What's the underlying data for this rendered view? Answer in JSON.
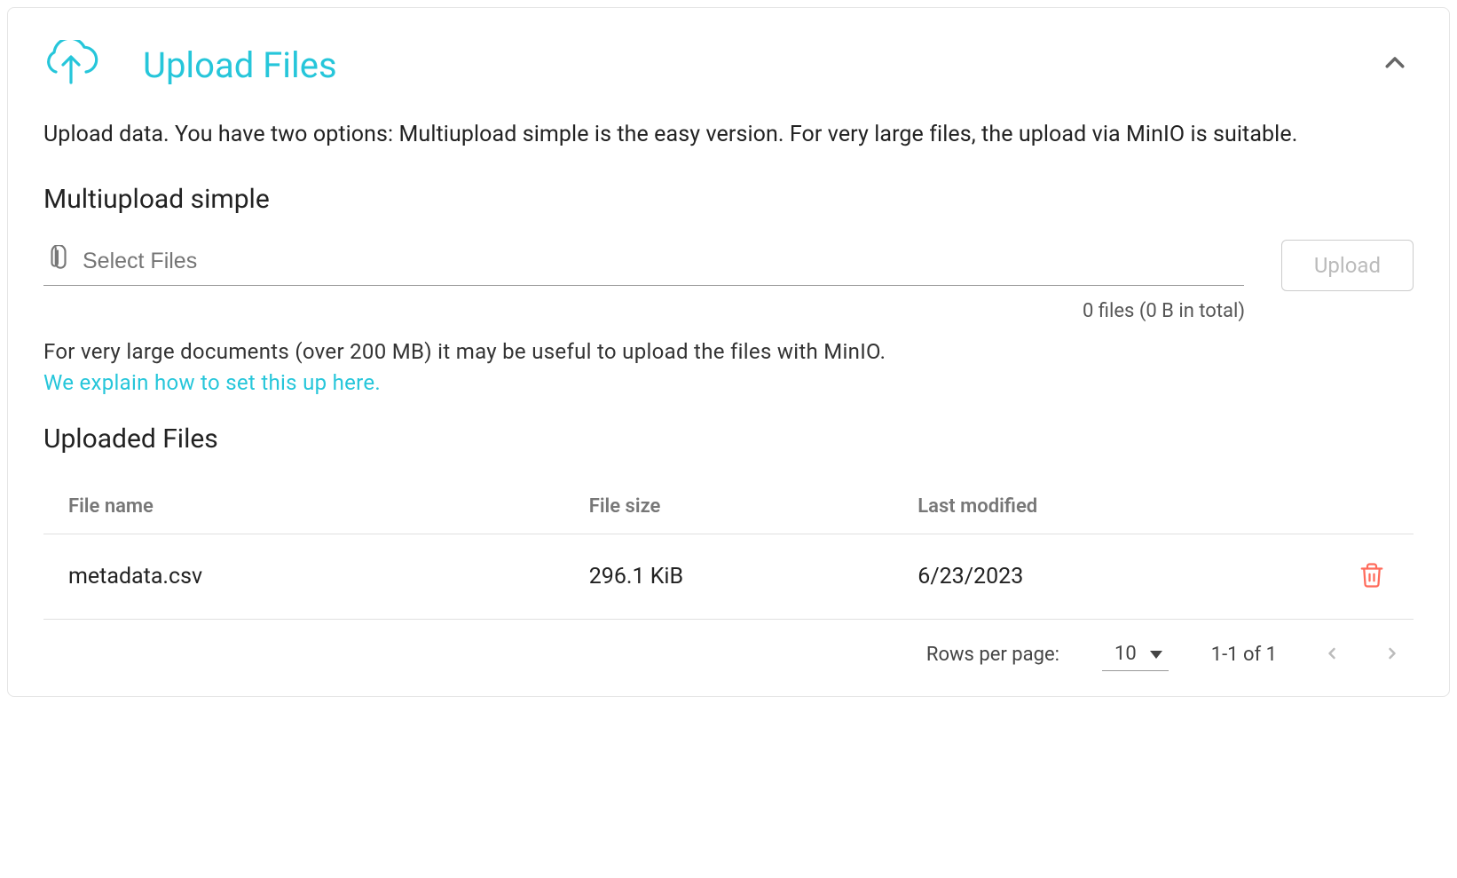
{
  "header": {
    "title": "Upload Files"
  },
  "description": "Upload data. You have two options: Multiupload simple is the easy version. For very large files, the upload via MinIO is suitable.",
  "multiupload": {
    "section_title": "Multiupload simple",
    "select_placeholder": "Select Files",
    "upload_button_label": "Upload",
    "status_text": "0 files (0 B in total)",
    "hint_text": "For very large documents (over 200 MB) it may be useful to upload the files with MinIO.",
    "hint_link": "We explain how to set this up here."
  },
  "uploaded": {
    "section_title": "Uploaded Files",
    "columns": {
      "file_name": "File name",
      "file_size": "File size",
      "last_modified": "Last modified"
    },
    "rows": [
      {
        "file_name": "metadata.csv",
        "file_size": "296.1 KiB",
        "last_modified": "6/23/2023"
      }
    ]
  },
  "pagination": {
    "rows_label": "Rows per page:",
    "rows_value": "10",
    "range_text": "1-1 of 1"
  }
}
